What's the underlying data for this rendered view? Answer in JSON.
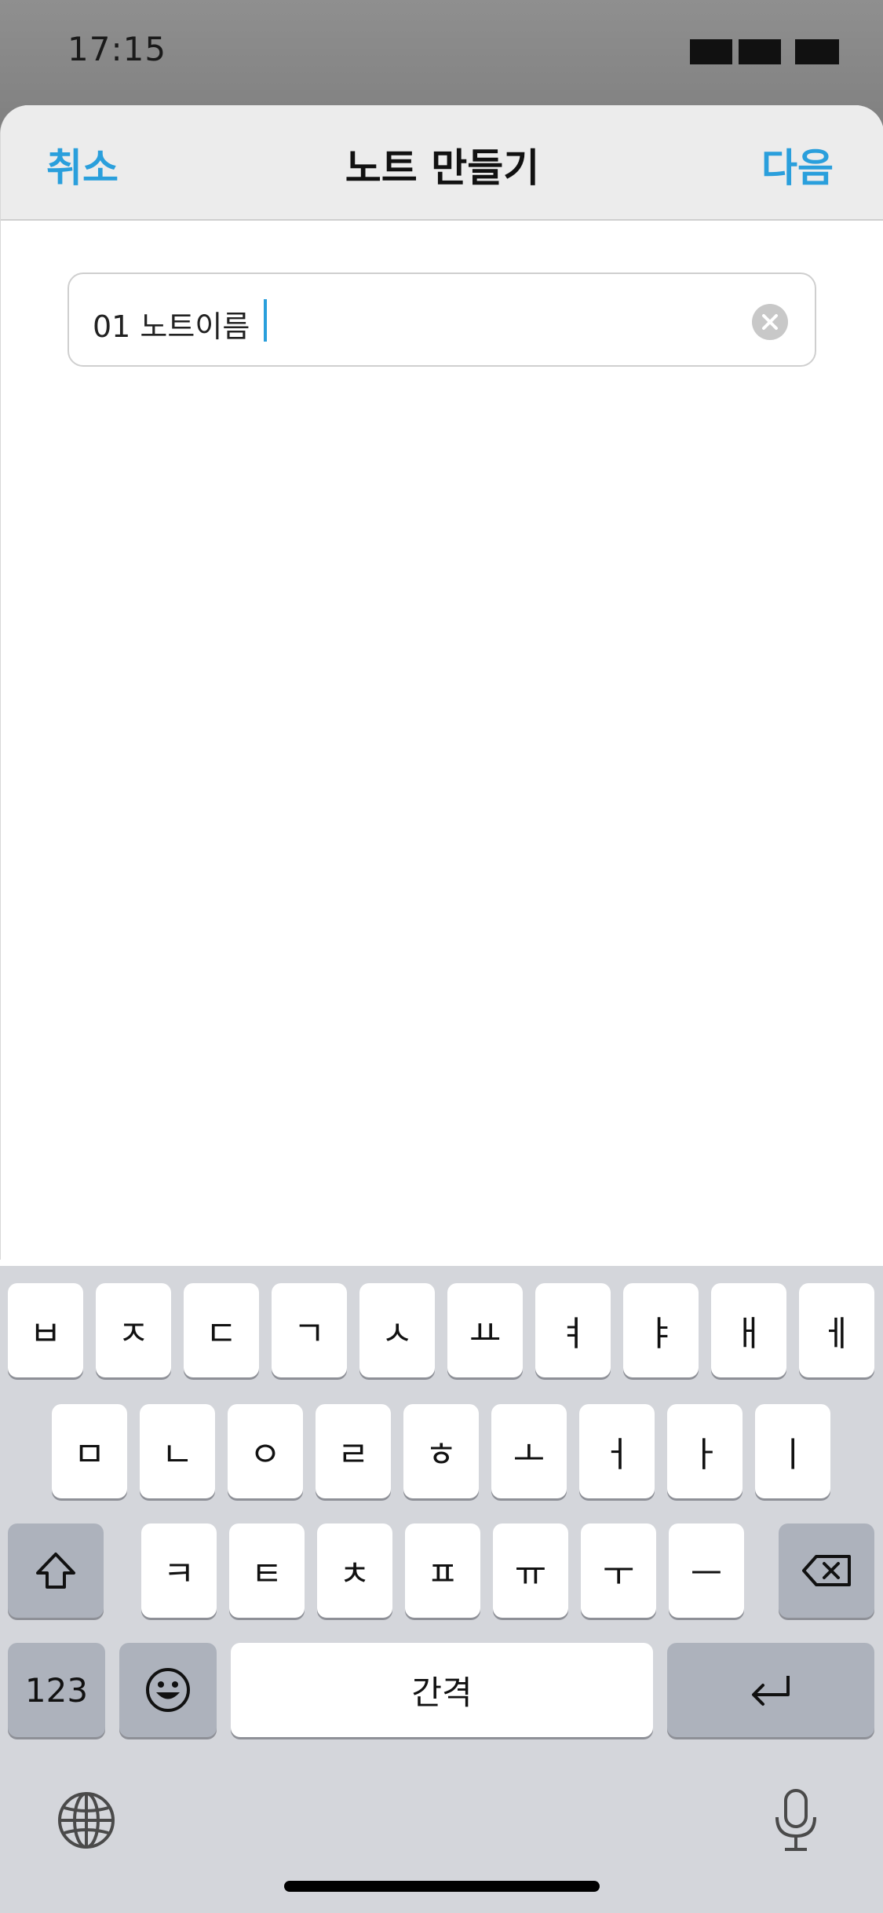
{
  "status_bar": {
    "time": "17:15"
  },
  "nav": {
    "cancel_label": "취소",
    "title": "노트 만들기",
    "next_label": "다음"
  },
  "note_name_input": {
    "value": "01 노트이름"
  },
  "keyboard": {
    "row1": [
      "ㅂ",
      "ㅈ",
      "ㄷ",
      "ㄱ",
      "ㅅ",
      "ㅛ",
      "ㅕ",
      "ㅑ",
      "ㅐ",
      "ㅔ"
    ],
    "row2": [
      "ㅁ",
      "ㄴ",
      "ㅇ",
      "ㄹ",
      "ㅎ",
      "ㅗ",
      "ㅓ",
      "ㅏ",
      "ㅣ"
    ],
    "row3": [
      "ㅋ",
      "ㅌ",
      "ㅊ",
      "ㅍ",
      "ㅠ",
      "ㅜ",
      "ㅡ"
    ],
    "numbers_label": "123",
    "space_label": "간격"
  },
  "colors": {
    "accent": "#2a9fdc",
    "keyboard_bg": "#d4d6db",
    "dark_key": "#adb2bc"
  }
}
